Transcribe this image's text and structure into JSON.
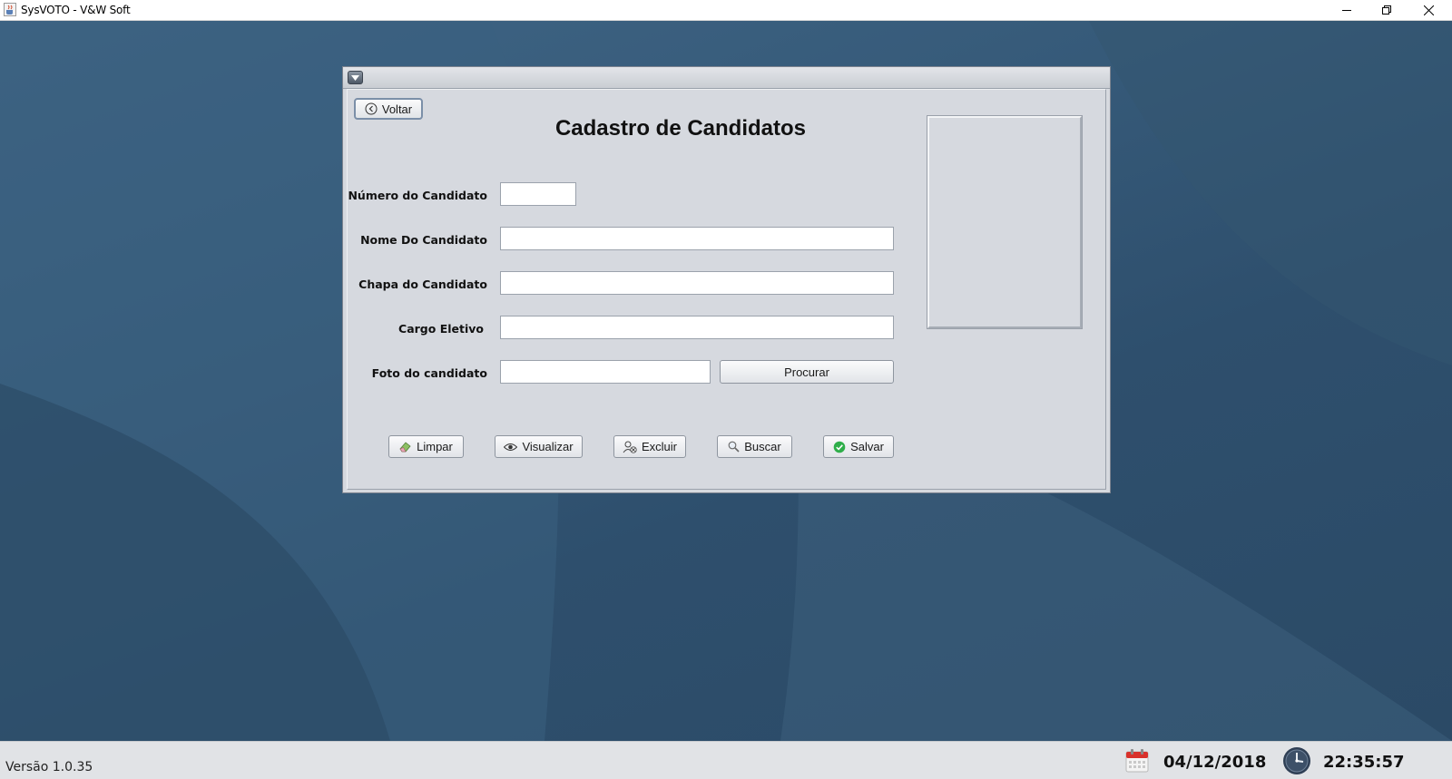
{
  "window": {
    "title": "SysVOTO - V&W Soft",
    "app_icon": "java-cup-icon",
    "controls": [
      "minimize-icon",
      "restore-icon",
      "close-icon"
    ]
  },
  "form": {
    "back_label": "Voltar",
    "title": "Cadastro de Candidatos",
    "fields": {
      "numero": {
        "label": "Número do Candidato",
        "value": ""
      },
      "nome": {
        "label": "Nome Do Candidato",
        "value": ""
      },
      "chapa": {
        "label": "Chapa do Candidato",
        "value": ""
      },
      "cargo": {
        "label": "Cargo Eletivo",
        "value": ""
      },
      "foto": {
        "label": "Foto do candidato",
        "value": ""
      }
    },
    "browse_label": "Procurar",
    "actions": {
      "limpar": "Limpar",
      "visualizar": "Visualizar",
      "excluir": "Excluir",
      "buscar": "Buscar",
      "salvar": "Salvar"
    }
  },
  "status": {
    "version": "Versão 1.0.35",
    "date": "04/12/2018",
    "time": "22:35:57"
  },
  "colors": {
    "desktop": "#2f4f6c",
    "frame_bg": "#d6d9df",
    "salvar_icon": "#2fae4a",
    "calendar_accent": "#d9312b"
  }
}
